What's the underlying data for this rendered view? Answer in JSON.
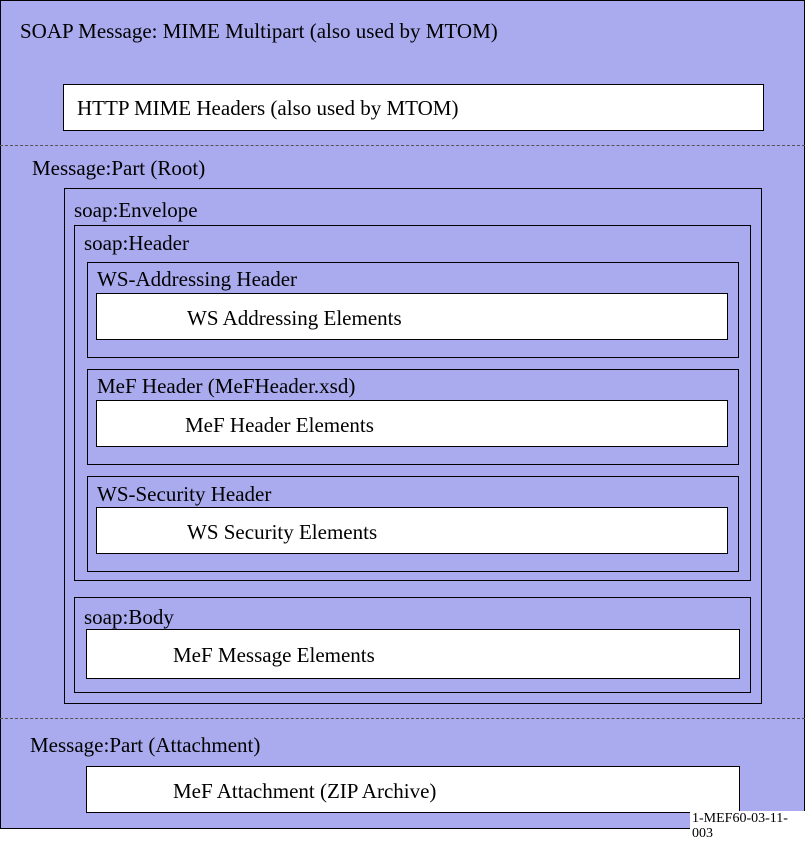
{
  "soap_message": {
    "title": "SOAP Message:  MIME Multipart (also used by MTOM)"
  },
  "http_headers": {
    "label": "HTTP MIME Headers (also used by MTOM)"
  },
  "root_part": {
    "label": "Message:Part (Root)"
  },
  "envelope": {
    "label": "soap:Envelope",
    "header": {
      "label": "soap:Header",
      "ws_addressing": {
        "label": "WS-Addressing Header",
        "elements": "WS Addressing Elements"
      },
      "mef_header": {
        "label": "MeF Header (MeFHeader.xsd)",
        "elements": "MeF Header Elements"
      },
      "ws_security": {
        "label": "WS-Security Header",
        "elements": "WS Security Elements"
      }
    },
    "body": {
      "label": "soap:Body",
      "elements": "MeF Message Elements"
    }
  },
  "attachment_part": {
    "label": "Message:Part (Attachment)",
    "content": "MeF Attachment (ZIP Archive)"
  },
  "figure_id": "1-MEF60-03-11-003",
  "colors": {
    "fill": "#aaaaee",
    "content": "#ffffff",
    "border": "#000000"
  }
}
